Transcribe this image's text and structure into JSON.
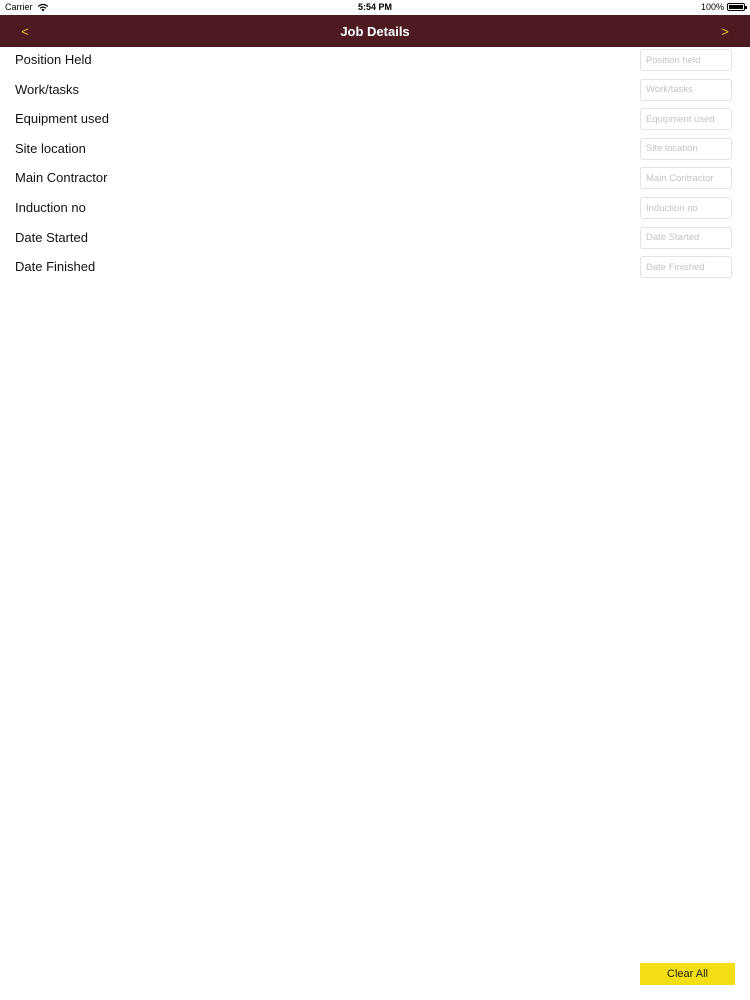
{
  "status_bar": {
    "carrier": "Carrier",
    "time": "5:54 PM",
    "battery": "100%"
  },
  "nav": {
    "back_label": "<",
    "title": "Job Details",
    "next_label": ">"
  },
  "form": {
    "fields": [
      {
        "label": "Position Held",
        "placeholder": "Position held",
        "value": ""
      },
      {
        "label": "Work/tasks",
        "placeholder": "Work/tasks",
        "value": ""
      },
      {
        "label": "Equipment used",
        "placeholder": "Equipment used",
        "value": ""
      },
      {
        "label": "Site location",
        "placeholder": "Site location",
        "value": ""
      },
      {
        "label": "Main Contractor",
        "placeholder": "Main Contractor",
        "value": ""
      },
      {
        "label": "Induction no",
        "placeholder": "Induction no",
        "value": ""
      },
      {
        "label": "Date Started",
        "placeholder": "Date Started",
        "value": ""
      },
      {
        "label": "Date Finished",
        "placeholder": "Date Finished",
        "value": ""
      }
    ]
  },
  "actions": {
    "clear_all_label": "Clear All"
  },
  "colors": {
    "nav_background": "#4e1a22",
    "nav_accent": "#f0c330",
    "clear_button": "#f2de13"
  }
}
